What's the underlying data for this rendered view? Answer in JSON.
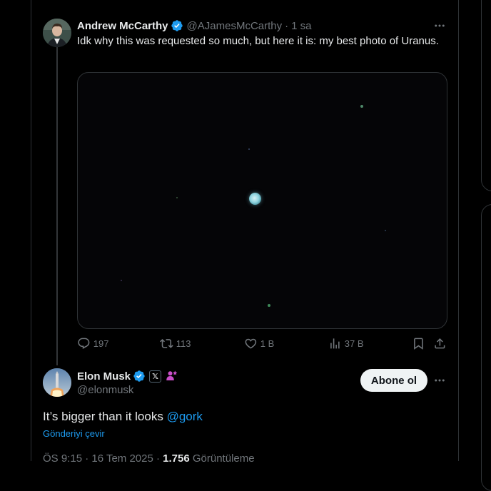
{
  "original_tweet": {
    "author_name": "Andrew McCarthy",
    "author_handle": "@AJamesMcCarthy",
    "separator": "·",
    "time": "1 sa",
    "text": "Idk why this was requested so much, but here it is: my best photo of Uranus.",
    "stats": {
      "replies": "197",
      "reposts": "113",
      "likes": "1 B",
      "views": "37 B"
    }
  },
  "reply_tweet": {
    "author_name": "Elon Musk",
    "author_handle": "@elonmusk",
    "org_badge": "𝕏",
    "follow_label": "Abone ol",
    "text_main": "It’s bigger than it looks ",
    "text_mention": "@gork",
    "translate_label": "Gönderiyi çevir",
    "timestamp": "ÖS 9:15 · 16 Tem 2025 · ",
    "view_count": "1.756",
    "view_label": " Görüntüleme"
  },
  "colors": {
    "background": "#000000",
    "accent": "#1d9bf0",
    "muted": "#71767b",
    "text": "#e7e9ea",
    "border": "#2f3336"
  }
}
